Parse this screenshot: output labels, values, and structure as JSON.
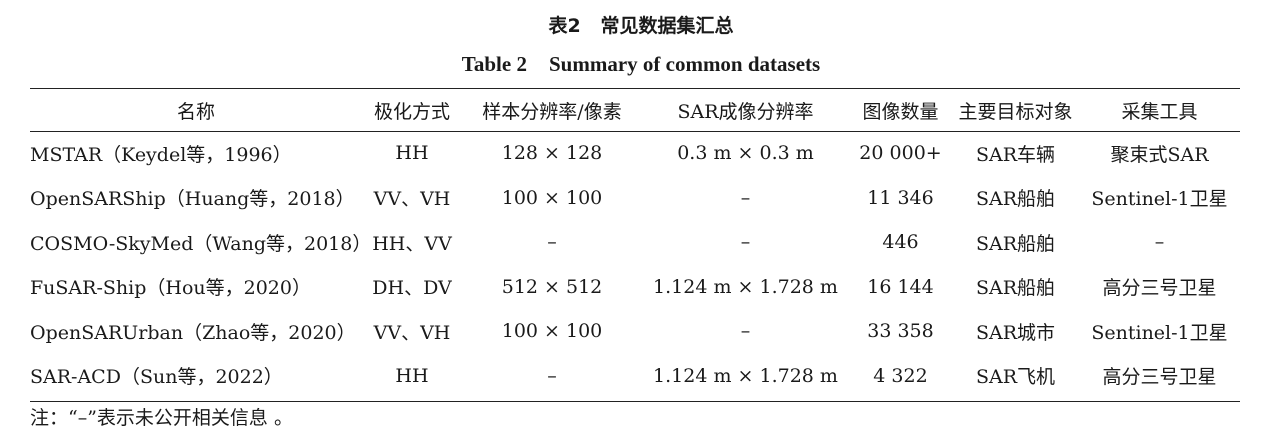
{
  "caption": {
    "cn_label": "表2",
    "cn_title": "常见数据集汇总",
    "en_label": "Table 2",
    "en_title": "Summary of common datasets"
  },
  "columns": [
    "名称",
    "极化方式",
    "样本分辨率/像素",
    "SAR成像分辨率",
    "图像数量",
    "主要目标对象",
    "采集工具"
  ],
  "rows": [
    [
      "MSTAR（Keydel等，1996）",
      "HH",
      "128 × 128",
      "0.3 m × 0.3 m",
      "20 000+",
      "SAR车辆",
      "聚束式SAR"
    ],
    [
      "OpenSARShip（Huang等，2018）",
      "VV、VH",
      "100 × 100",
      "–",
      "11 346",
      "SAR船舶",
      "Sentinel-1卫星"
    ],
    [
      "COSMO-SkyMed（Wang等，2018）",
      "HH、VV",
      "–",
      "–",
      "446",
      "SAR船舶",
      "–"
    ],
    [
      "FuSAR-Ship（Hou等，2020）",
      "DH、DV",
      "512 × 512",
      "1.124 m × 1.728 m",
      "16 144",
      "SAR船舶",
      "高分三号卫星"
    ],
    [
      "OpenSARUrban（Zhao等，2020）",
      "VV、VH",
      "100 × 100",
      "–",
      "33 358",
      "SAR城市",
      "Sentinel-1卫星"
    ],
    [
      "SAR-ACD（Sun等，2022）",
      "HH",
      "–",
      "1.124 m × 1.728 m",
      "4 322",
      "SAR飞机",
      "高分三号卫星"
    ]
  ],
  "note": "注：“–”表示未公开相关信息 。"
}
